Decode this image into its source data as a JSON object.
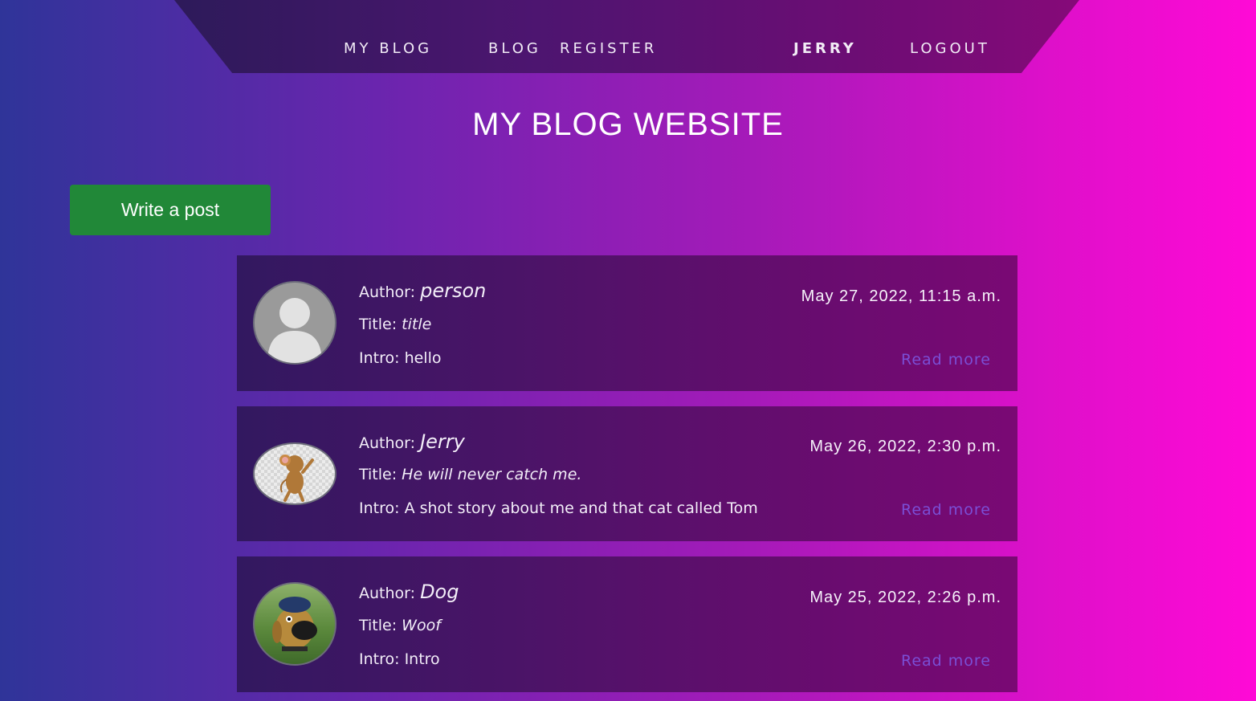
{
  "nav": {
    "my_blog": "MY BLOG",
    "blog": "BLOG",
    "register": "REGISTER",
    "user": "JERRY",
    "logout": "LOGOUT"
  },
  "page_title": "MY BLOG WEBSITE",
  "write_post_label": "Write a post",
  "labels": {
    "author": "Author: ",
    "title": "Title: ",
    "intro": "Intro: ",
    "read_more": "Read more"
  },
  "posts": [
    {
      "author": "person",
      "title": "title",
      "intro": "hello",
      "date": "May 27, 2022, 11:15 a.m.",
      "avatar": "default-person-avatar"
    },
    {
      "author": "Jerry",
      "title": "He will never catch me.",
      "intro": "A shot story about me and that cat called Tom",
      "date": "May 26, 2022, 2:30 p.m.",
      "avatar": "jerry-mouse-avatar"
    },
    {
      "author": "Dog",
      "title": "Woof",
      "intro": "Intro",
      "date": "May 25, 2022, 2:26 p.m.",
      "avatar": "dog-avatar"
    }
  ],
  "colors": {
    "write_button": "#218838",
    "read_more_link": "#7a4fd6",
    "background_start": "#2f3499",
    "background_end": "#ff0ad6"
  }
}
